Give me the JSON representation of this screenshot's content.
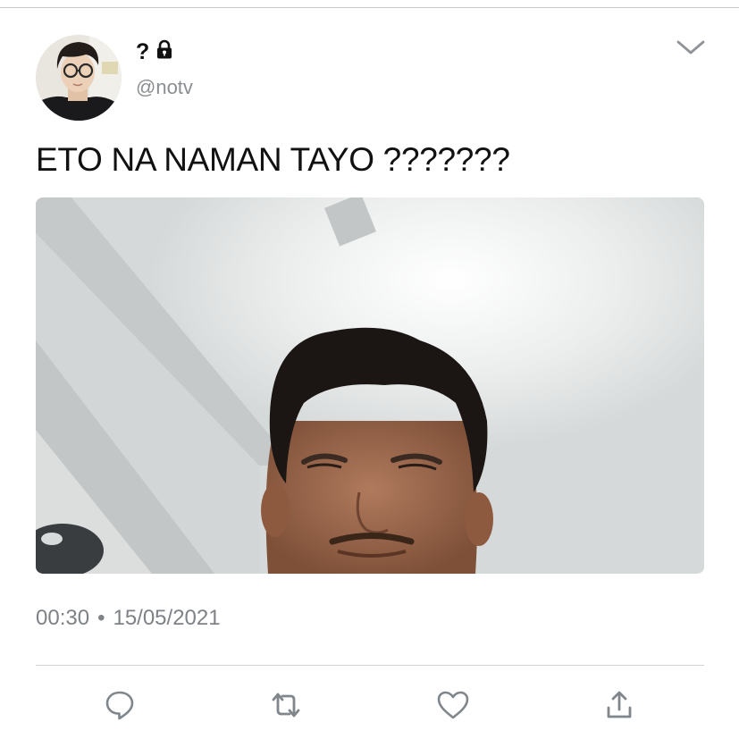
{
  "author": {
    "display_name": "?",
    "handle": "@notv",
    "protected_icon": "lock-icon"
  },
  "menu_icon": "chevron-down-icon",
  "tweet": {
    "text": "ETO NA NAMAN TAYO ???????",
    "time": "00:30",
    "separator": "•",
    "date": "15/05/2021"
  },
  "actions": [
    {
      "name": "reply",
      "icon": "reply-icon"
    },
    {
      "name": "retweet",
      "icon": "retweet-icon"
    },
    {
      "name": "like",
      "icon": "heart-icon"
    },
    {
      "name": "share",
      "icon": "share-icon"
    }
  ],
  "colors": {
    "icon_gray": "#7f868c",
    "text_secondary": "#7e8287",
    "divider": "#d0d3d6"
  }
}
